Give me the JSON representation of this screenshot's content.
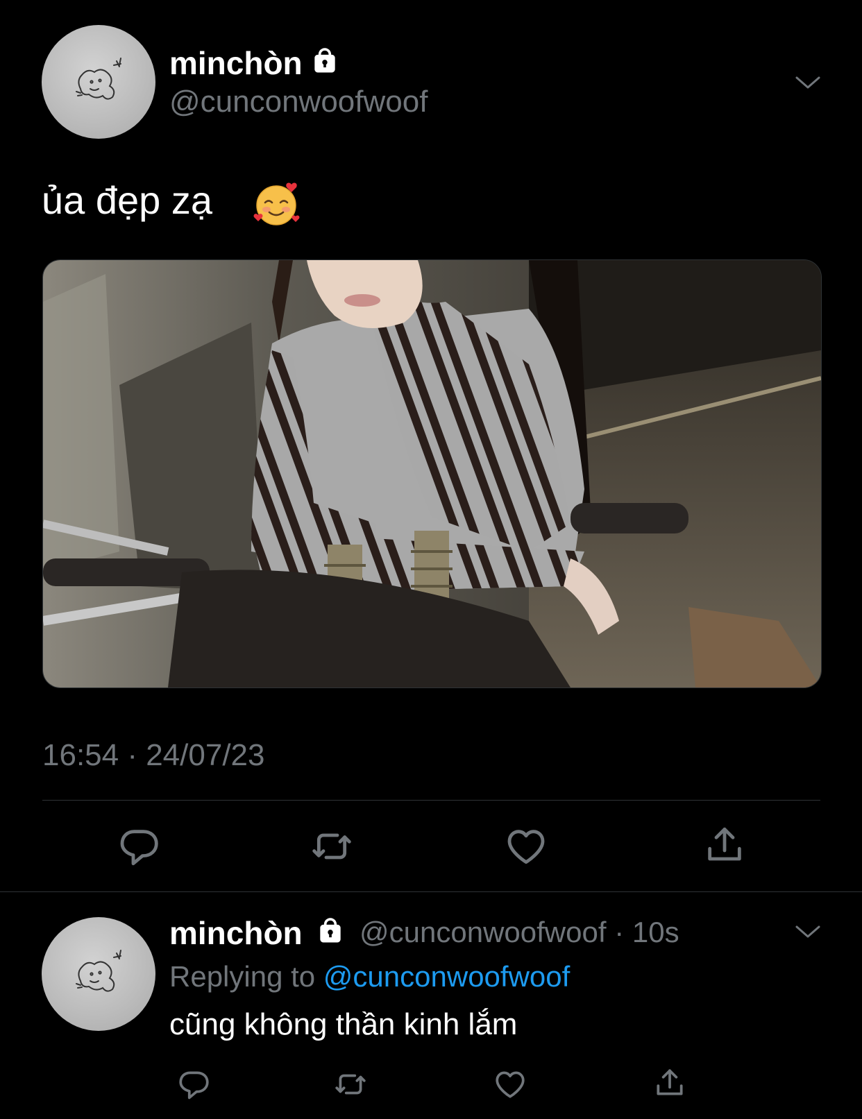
{
  "tweet": {
    "display_name": "minchòn",
    "handle": "@cunconwoofwoof",
    "text": "ủa đẹp zạ",
    "emoji_icon": "smiling-face-with-hearts",
    "timestamp": "16:54 · 24/07/23",
    "actions": [
      "reply-icon",
      "retweet-icon",
      "like-icon",
      "share-icon"
    ]
  },
  "reply": {
    "display_name": "minchòn",
    "handle": "@cunconwoofwoof",
    "separator": "·",
    "time_ago": "10s",
    "replying_label": "Replying to",
    "replying_handle": "@cunconwoofwoof",
    "text": "cũng không thần kinh lắm",
    "actions": [
      "reply-icon",
      "retweet-icon",
      "like-icon",
      "share-icon"
    ]
  },
  "colors": {
    "background": "#000000",
    "secondary_text": "#71767b",
    "link": "#1d9bf0",
    "divider": "#2f3336"
  }
}
